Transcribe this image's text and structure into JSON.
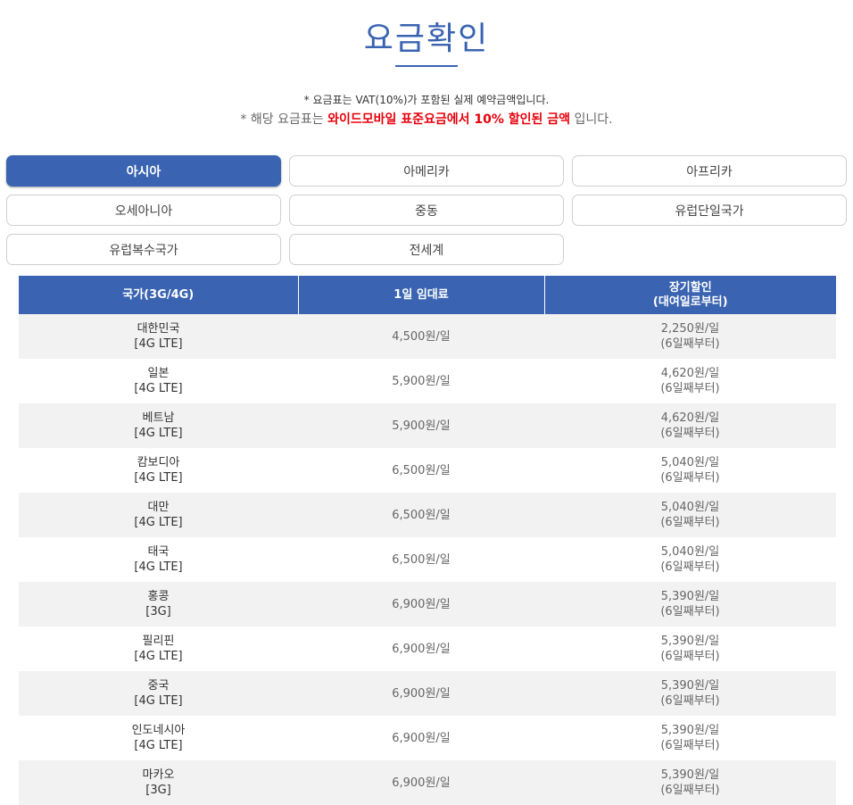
{
  "page": {
    "title": "요금확인",
    "note_vat": "* 요금표는 VAT(10%)가 포함된 실제 예약금액입니다.",
    "note_discount": {
      "prefix": "* 해당 요금표는 ",
      "highlight": "와이드모바일 표준요금에서 10% 할인된 금액",
      "suffix": " 입니다."
    }
  },
  "regions": [
    {
      "label": "아시아",
      "active": true
    },
    {
      "label": "아메리카",
      "active": false
    },
    {
      "label": "아프리카",
      "active": false
    },
    {
      "label": "오세아니아",
      "active": false
    },
    {
      "label": "중동",
      "active": false
    },
    {
      "label": "유럽단일국가",
      "active": false
    },
    {
      "label": "유럽복수국가",
      "active": false
    },
    {
      "label": "전세계",
      "active": false
    }
  ],
  "table": {
    "headers": {
      "country": "국가(3G/4G)",
      "daily": "1일 임대료",
      "long_term_1": "장기할인",
      "long_term_2": "(대여일로부터)"
    },
    "rows": [
      {
        "name": "대한민국",
        "network": "[4G LTE]",
        "daily": "4,500원/일",
        "discount": "2,250원/일",
        "discount_note": "(6일째부터)"
      },
      {
        "name": "일본",
        "network": "[4G LTE]",
        "daily": "5,900원/일",
        "discount": "4,620원/일",
        "discount_note": "(6일째부터)"
      },
      {
        "name": "베트남",
        "network": "[4G LTE]",
        "daily": "5,900원/일",
        "discount": "4,620원/일",
        "discount_note": "(6일째부터)"
      },
      {
        "name": "캄보디아",
        "network": "[4G LTE]",
        "daily": "6,500원/일",
        "discount": "5,040원/일",
        "discount_note": "(6일째부터)"
      },
      {
        "name": "대만",
        "network": "[4G LTE]",
        "daily": "6,500원/일",
        "discount": "5,040원/일",
        "discount_note": "(6일째부터)"
      },
      {
        "name": "태국",
        "network": "[4G LTE]",
        "daily": "6,500원/일",
        "discount": "5,040원/일",
        "discount_note": "(6일째부터)"
      },
      {
        "name": "홍콩",
        "network": "[3G]",
        "daily": "6,900원/일",
        "discount": "5,390원/일",
        "discount_note": "(6일째부터)"
      },
      {
        "name": "필리핀",
        "network": "[4G LTE]",
        "daily": "6,900원/일",
        "discount": "5,390원/일",
        "discount_note": "(6일째부터)"
      },
      {
        "name": "중국",
        "network": "[4G LTE]",
        "daily": "6,900원/일",
        "discount": "5,390원/일",
        "discount_note": "(6일째부터)"
      },
      {
        "name": "인도네시아",
        "network": "[4G LTE]",
        "daily": "6,900원/일",
        "discount": "5,390원/일",
        "discount_note": "(6일째부터)"
      },
      {
        "name": "마카오",
        "network": "[3G]",
        "daily": "6,900원/일",
        "discount": "5,390원/일",
        "discount_note": "(6일째부터)"
      }
    ]
  },
  "colors": {
    "accent": "#3a64b1",
    "highlight": "#e8000b"
  }
}
